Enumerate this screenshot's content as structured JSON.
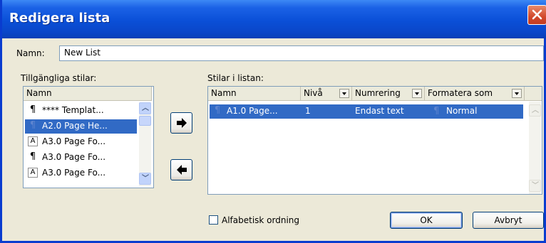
{
  "window": {
    "title": "Redigera lista"
  },
  "name_field": {
    "label": "Namn:",
    "value": "New List"
  },
  "available": {
    "label": "Tillgängliga stilar:",
    "column": "Namn",
    "items": [
      {
        "icon": "pilcrow-icon",
        "text": "**** Templat...",
        "selected": false
      },
      {
        "icon": "pilcrow-icon",
        "text": "A2.0 Page He...",
        "selected": true
      },
      {
        "icon": "a-char-style-icon",
        "text": "A3.0 Page Fo...",
        "selected": false
      },
      {
        "icon": "pilcrow-icon",
        "text": "A3.0 Page Fo...",
        "selected": false
      },
      {
        "icon": "a-char-style-icon",
        "text": "A3.0 Page Fo...",
        "selected": false
      }
    ]
  },
  "in_list": {
    "label": "Stilar i listan:",
    "columns": [
      "Namn",
      "Nivå",
      "Numrering",
      "Formatera som"
    ],
    "rows": [
      {
        "name": "A1.0 Page...",
        "level": "1",
        "numbering": "Endast text",
        "format_as": "Normal",
        "selected": true
      }
    ]
  },
  "move_buttons": {
    "add_icon": "arrow-right-icon",
    "remove_icon": "arrow-left-icon"
  },
  "alphabetical": {
    "label": "Alfabetisk ordning",
    "checked": false
  },
  "buttons": {
    "ok": "OK",
    "cancel": "Avbryt"
  },
  "colors": {
    "title_bar": "#0a4fd7",
    "selection": "#316ac5",
    "dialog_bg": "#ece9d8",
    "close": "#d2492b"
  }
}
